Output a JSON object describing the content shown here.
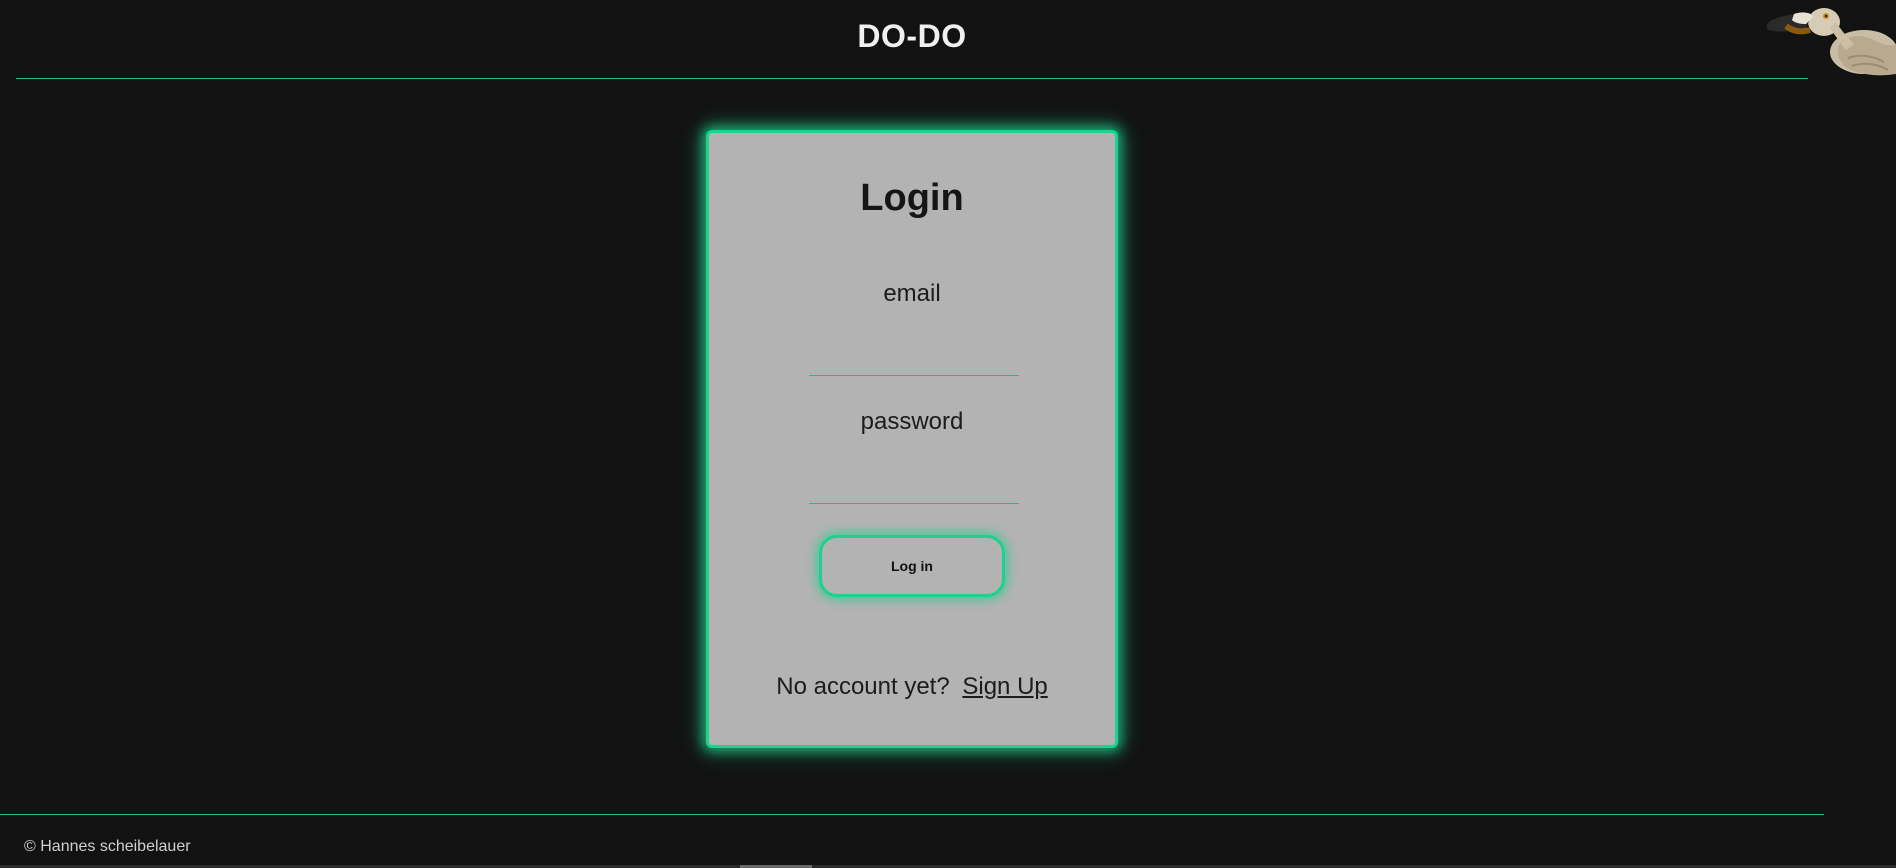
{
  "header": {
    "title": "DO-DO",
    "logo_icon": "dodo-bird-icon"
  },
  "login": {
    "title": "Login",
    "email_label": "email",
    "email_value": "",
    "password_label": "password",
    "password_value": "",
    "button_label": "Log in",
    "signup_prompt": "No account yet?",
    "signup_link": "Sign Up"
  },
  "footer": {
    "copyright": "© Hannes scheibelauer"
  },
  "colors": {
    "background": "#121212",
    "accent": "#1fd08f",
    "card": "#b3b3b3"
  }
}
